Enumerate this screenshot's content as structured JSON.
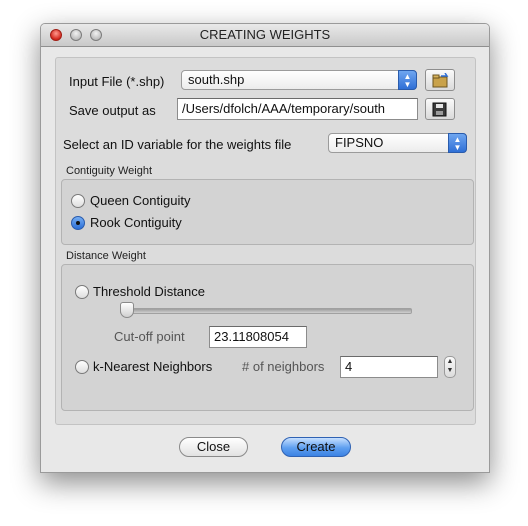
{
  "window": {
    "title": "CREATING WEIGHTS"
  },
  "input_file": {
    "label": "Input File (*.shp)",
    "value": "south.shp"
  },
  "save_output": {
    "label": "Save output as",
    "value": "/Users/dfolch/AAA/temporary/south"
  },
  "id_variable": {
    "label": "Select an ID variable for the weights file",
    "value": "FIPSNO"
  },
  "contiguity": {
    "title": "Contiguity Weight",
    "options": [
      {
        "label": "Queen Contiguity",
        "selected": false
      },
      {
        "label": "Rook Contiguity",
        "selected": true
      }
    ]
  },
  "distance": {
    "title": "Distance Weight",
    "threshold": {
      "label": "Threshold Distance",
      "selected": false,
      "slider_fraction": 0.0
    },
    "cutoff": {
      "label": "Cut-off point",
      "value": "23.11808054"
    },
    "knn": {
      "label": "k-Nearest Neighbors",
      "selected": false,
      "neighbors_label": "# of neighbors",
      "neighbors_value": "4"
    }
  },
  "buttons": {
    "close": "Close",
    "create": "Create"
  },
  "icons": {
    "open": "open-folder-icon",
    "save": "floppy-disk-icon"
  }
}
